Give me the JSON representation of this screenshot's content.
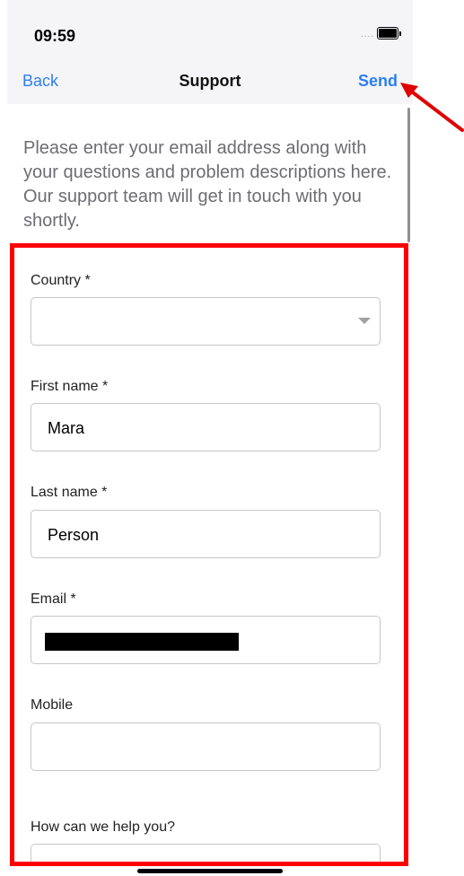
{
  "status_bar": {
    "time": "09:59",
    "signal_dots": "....",
    "battery_icon": "battery-icon"
  },
  "nav": {
    "back_label": "Back",
    "title": "Support",
    "send_label": "Send"
  },
  "intro_text": "Please enter your email address along with your questions and problem descriptions here. Our support team will get in touch with you shortly.",
  "form": {
    "country": {
      "label": "Country *",
      "value": ""
    },
    "first_name": {
      "label": "First name *",
      "value": "Mara"
    },
    "last_name": {
      "label": "Last name *",
      "value": "Person"
    },
    "email": {
      "label": "Email *",
      "value": ""
    },
    "mobile": {
      "label": "Mobile",
      "value": ""
    },
    "help": {
      "label": "How can we help you?",
      "value": ""
    }
  },
  "colors": {
    "accent": "#2c7ef3",
    "highlight": "#ff0000",
    "bar_background": "#f5f5f7"
  }
}
